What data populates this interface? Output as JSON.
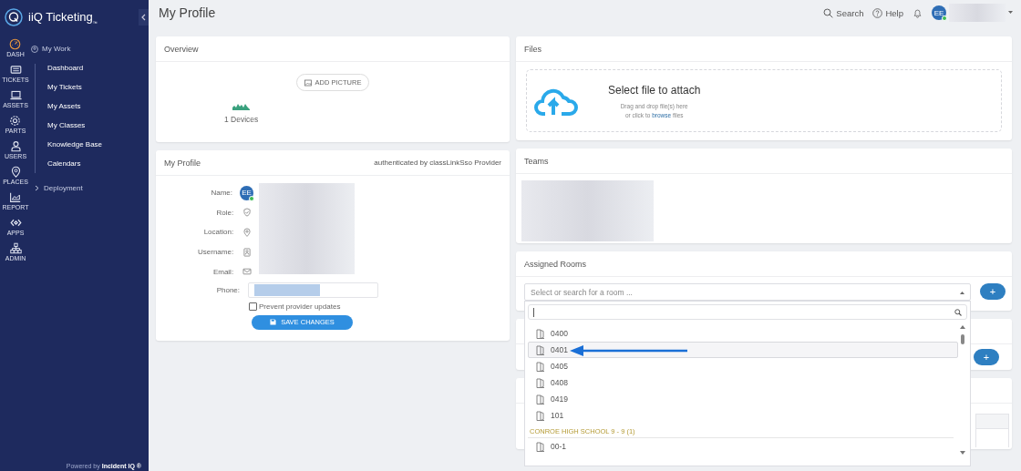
{
  "sidebar": {
    "logo": "iiQ Ticketing",
    "logo_mark": "™",
    "rail": [
      {
        "label": "DASH",
        "kind": "dash",
        "selected": true
      },
      {
        "label": "TICKETS",
        "kind": "tickets",
        "selected": false
      },
      {
        "label": "ASSETS",
        "kind": "assets",
        "selected": false
      },
      {
        "label": "PARTS",
        "kind": "parts",
        "selected": false
      },
      {
        "label": "USERS",
        "kind": "users",
        "selected": false
      },
      {
        "label": "PLACES",
        "kind": "places",
        "selected": false
      },
      {
        "label": "REPORT",
        "kind": "report",
        "selected": false
      },
      {
        "label": "APPS",
        "kind": "apps",
        "selected": false
      },
      {
        "label": "ADMIN",
        "kind": "admin",
        "selected": false
      }
    ],
    "section": "My Work",
    "items": [
      "Dashboard",
      "My Tickets",
      "My Assets",
      "My Classes",
      "Knowledge Base",
      "Calendars"
    ],
    "group": {
      "label": "Deployment",
      "expanded": false
    },
    "footer": "Powered by **Incident IQ ®**"
  },
  "header": {
    "title": "My Profile",
    "search": "Search",
    "help": "Help",
    "avatar": "EE",
    "online": true
  },
  "overview": {
    "title": "Overview",
    "add_picture": "ADD PICTURE",
    "devices": "1 Devices"
  },
  "profile": {
    "title": "My Profile",
    "provider": "authenticated by classLinkSso Provider",
    "fields": [
      {
        "label": "Name:",
        "kind": "name",
        "avatar": "EE"
      },
      {
        "label": "Role:",
        "kind": "role"
      },
      {
        "label": "Location:",
        "kind": "location"
      },
      {
        "label": "Username:",
        "kind": "username"
      },
      {
        "label": "Email:",
        "kind": "email"
      }
    ],
    "phone_label": "Phone:",
    "prevent": {
      "label": "Prevent provider updates",
      "checked": false
    },
    "save": "SAVE CHANGES"
  },
  "files": {
    "title": "Files",
    "heading": "Select file to attach",
    "hint": "Drag and drop file(s) here",
    "hint_before": "or click to",
    "link": "browse",
    "hint_after": "files"
  },
  "teams": {
    "title": "Teams"
  },
  "rooms": {
    "title": "Assigned Rooms",
    "placeholder": "Select or search for a room ...",
    "expanded": true,
    "options": [
      {
        "label": "0400",
        "kind": "room",
        "selected": false
      },
      {
        "label": "0401",
        "kind": "room",
        "selected": true
      },
      {
        "label": "0405",
        "kind": "room",
        "selected": false
      },
      {
        "label": "0408",
        "kind": "room",
        "selected": false
      },
      {
        "label": "0419",
        "kind": "room",
        "selected": false
      },
      {
        "label": "101",
        "kind": "room",
        "selected": false
      },
      {
        "label": "CONROE HIGH SCHOOL 9 - 9 (1)",
        "kind": "group"
      },
      {
        "label": "00-1",
        "kind": "room",
        "selected": false
      }
    ]
  },
  "add_buttons": [
    "+",
    "+"
  ]
}
